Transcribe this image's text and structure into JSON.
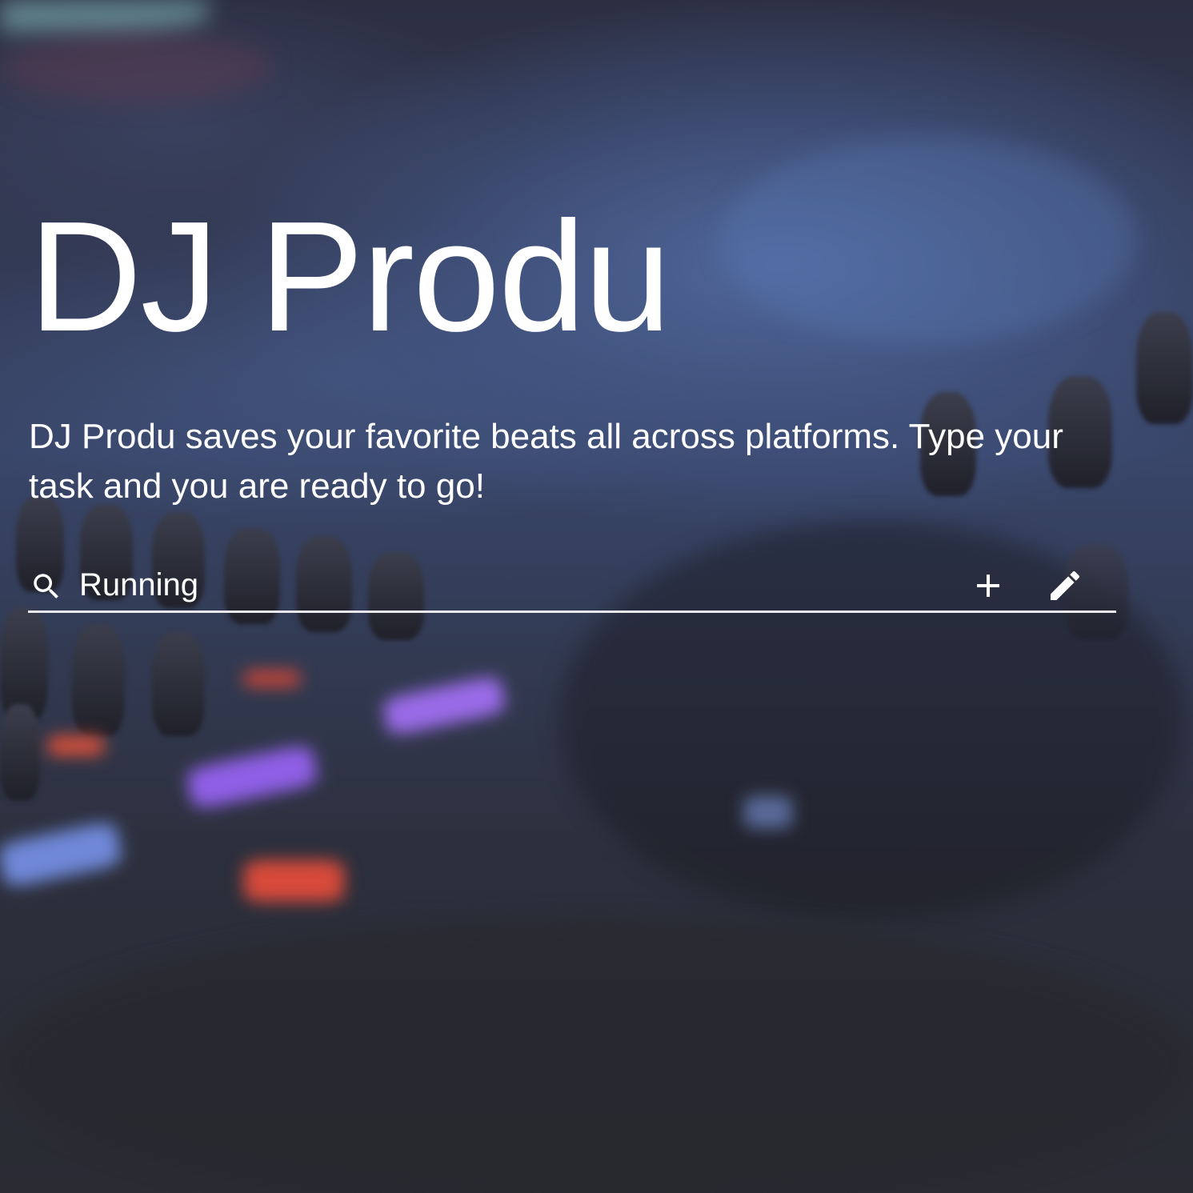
{
  "app": {
    "title": "DJ Produ",
    "description": "DJ Produ saves your favorite beats all across platforms. Type your task and you are ready to go!"
  },
  "search": {
    "value": "Running",
    "icon": "search-icon"
  },
  "actions": {
    "add_icon": "plus-icon",
    "edit_icon": "pencil-icon"
  },
  "colors": {
    "text": "#ffffff",
    "underline": "#e8e8ec",
    "background": "#2b2c36"
  }
}
